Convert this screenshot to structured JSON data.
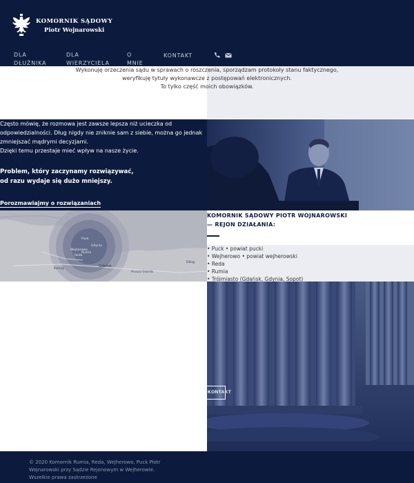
{
  "header": {
    "brand_line1": "KOMORNIK SĄDOWY",
    "brand_line2": "Piotr Wojnarowski",
    "nav": [
      {
        "label": "DLA DŁUŻNIKA"
      },
      {
        "label": "DLA WIERZYCIELA"
      },
      {
        "label": "O MNIE"
      },
      {
        "label": "KONTAKT"
      }
    ],
    "icons": [
      "phone-icon",
      "mail-icon"
    ]
  },
  "intro": {
    "text": "Wykonuję orzeczenia sądu w sprawach o roszczenia, sporządzam protokoły stanu faktycznego, weryfikuję tytuły wykonawcze z postępowań elektronicznych.",
    "text2": "To tylko część moich obowiązków."
  },
  "about": {
    "paragraph": "Często mówię, że rozmowa jest zawsze lepsza niż ucieczka od odpowiedzialności. Dług nigdy nie zniknie sam z siebie, można go jednak zmniejszać mądrymi decyzjami.",
    "paragraph2": "Dzięki temu przestaje mieć wpływ na nasze życie.",
    "bold_line1": "Problem, który zaczynamy rozwiązywać,",
    "bold_line2": "od razu wydaje się dużo mniejszy.",
    "cta": "Porozmawiajmy o rozwiązaniach"
  },
  "map": {
    "labels": [
      "Puck",
      "Gdynia",
      "Gdańsk",
      "Rumia",
      "Wejherowo",
      "Reda",
      "Kartuzy",
      "Pruszcz Gdański",
      "Elbląg"
    ]
  },
  "region": {
    "title_line1": "KOMORNIK SĄDOWY PIOTR WOJNAROWSKI",
    "title_line2": "— REJON DZIAŁANIA:",
    "items": [
      "• Puck • powiat pucki",
      "• Wejherowo • powiat wejherowski",
      "• Reda",
      "• Rumia",
      "• Trójmiasto (Gdańsk, Gdynia, Sopot)"
    ]
  },
  "contact_button": "KONTAKT",
  "footer": {
    "text": "© 2020 Komornik Rumia, Reda, Wejherowo, Puck Piotr Wojnarowski przy Sądzie Rejonowym w Wejherowie. Wszelkie prawa zastrzeżone"
  },
  "colors": {
    "navy": "#0c1b3d",
    "light_gray": "#ecedf2",
    "map_gray": "#c4c6cc"
  }
}
